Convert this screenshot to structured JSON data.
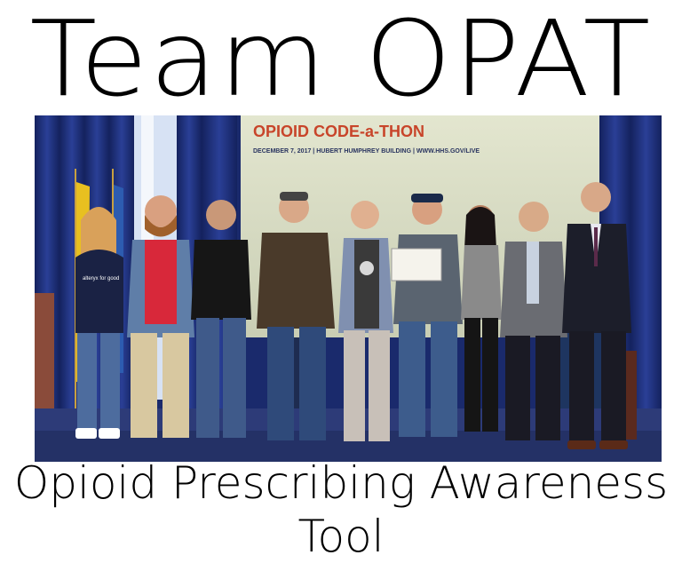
{
  "header": {
    "title": "Team OPAT"
  },
  "footer": {
    "subtitle": "Opioid Prescribing Awareness Tool"
  },
  "photo": {
    "banner_title": "OPIOID CODE-a-THON",
    "banner_subtitle": "DECEMBER 7, 2017 | HUBERT HUMPHREY BUILDING | WWW.HHS.GOV/LIVE",
    "shirt_text": "alteryx for good",
    "colors": {
      "curtain": "#1c2f78",
      "banner": "#d9ddc4",
      "banner_title": "#c8452a",
      "banner_subtitle": "#2a3560",
      "floor": "#2d3b78"
    }
  }
}
